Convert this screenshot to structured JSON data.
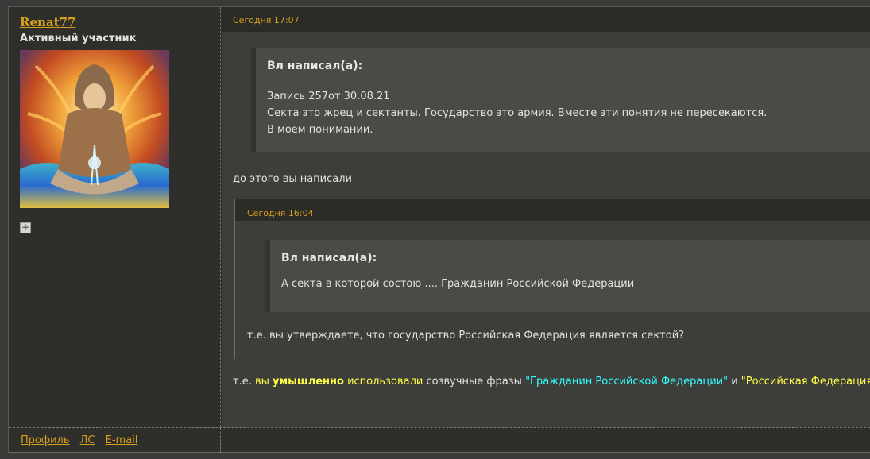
{
  "user": {
    "name": "Renat77",
    "title": "Активный участник",
    "plus_label": "+"
  },
  "post": {
    "date": "Сегодня 17:07",
    "quote1": {
      "author": "Вл написал(а):",
      "lines": [
        "Запись 257от 30.08.21",
        "Секта это жрец и сектанты. Государство это армия. Вместе эти понятия не пересекаются.",
        "В моем понимании."
      ]
    },
    "intro": "до этого вы написали",
    "nested": {
      "date": "Сегодня 16:04",
      "quote": {
        "author": "Вл написал(а):",
        "text": "А секта в которой состою .... Гражданин Российской Федерации"
      },
      "reply": "т.е. вы утверждаете, что государство Российская Федерация является сектой?"
    },
    "final": {
      "p1": "т.е. ",
      "p2": "вы ",
      "p3": "умышленно",
      "p4": " использовали",
      "p5": " созвучные фразы ",
      "p6": "\"Гражданин Российской Федерации\"",
      "p7": " и ",
      "p8": "\"Российская Федерация\"",
      "p9": " ?"
    }
  },
  "footer": {
    "profile": "Профиль",
    "pm": "ЛС",
    "email": "E-mail"
  },
  "colors": {
    "link": "#d6a01e",
    "highlight_yellow": "#ffff4a",
    "highlight_cyan": "#33ffff"
  }
}
